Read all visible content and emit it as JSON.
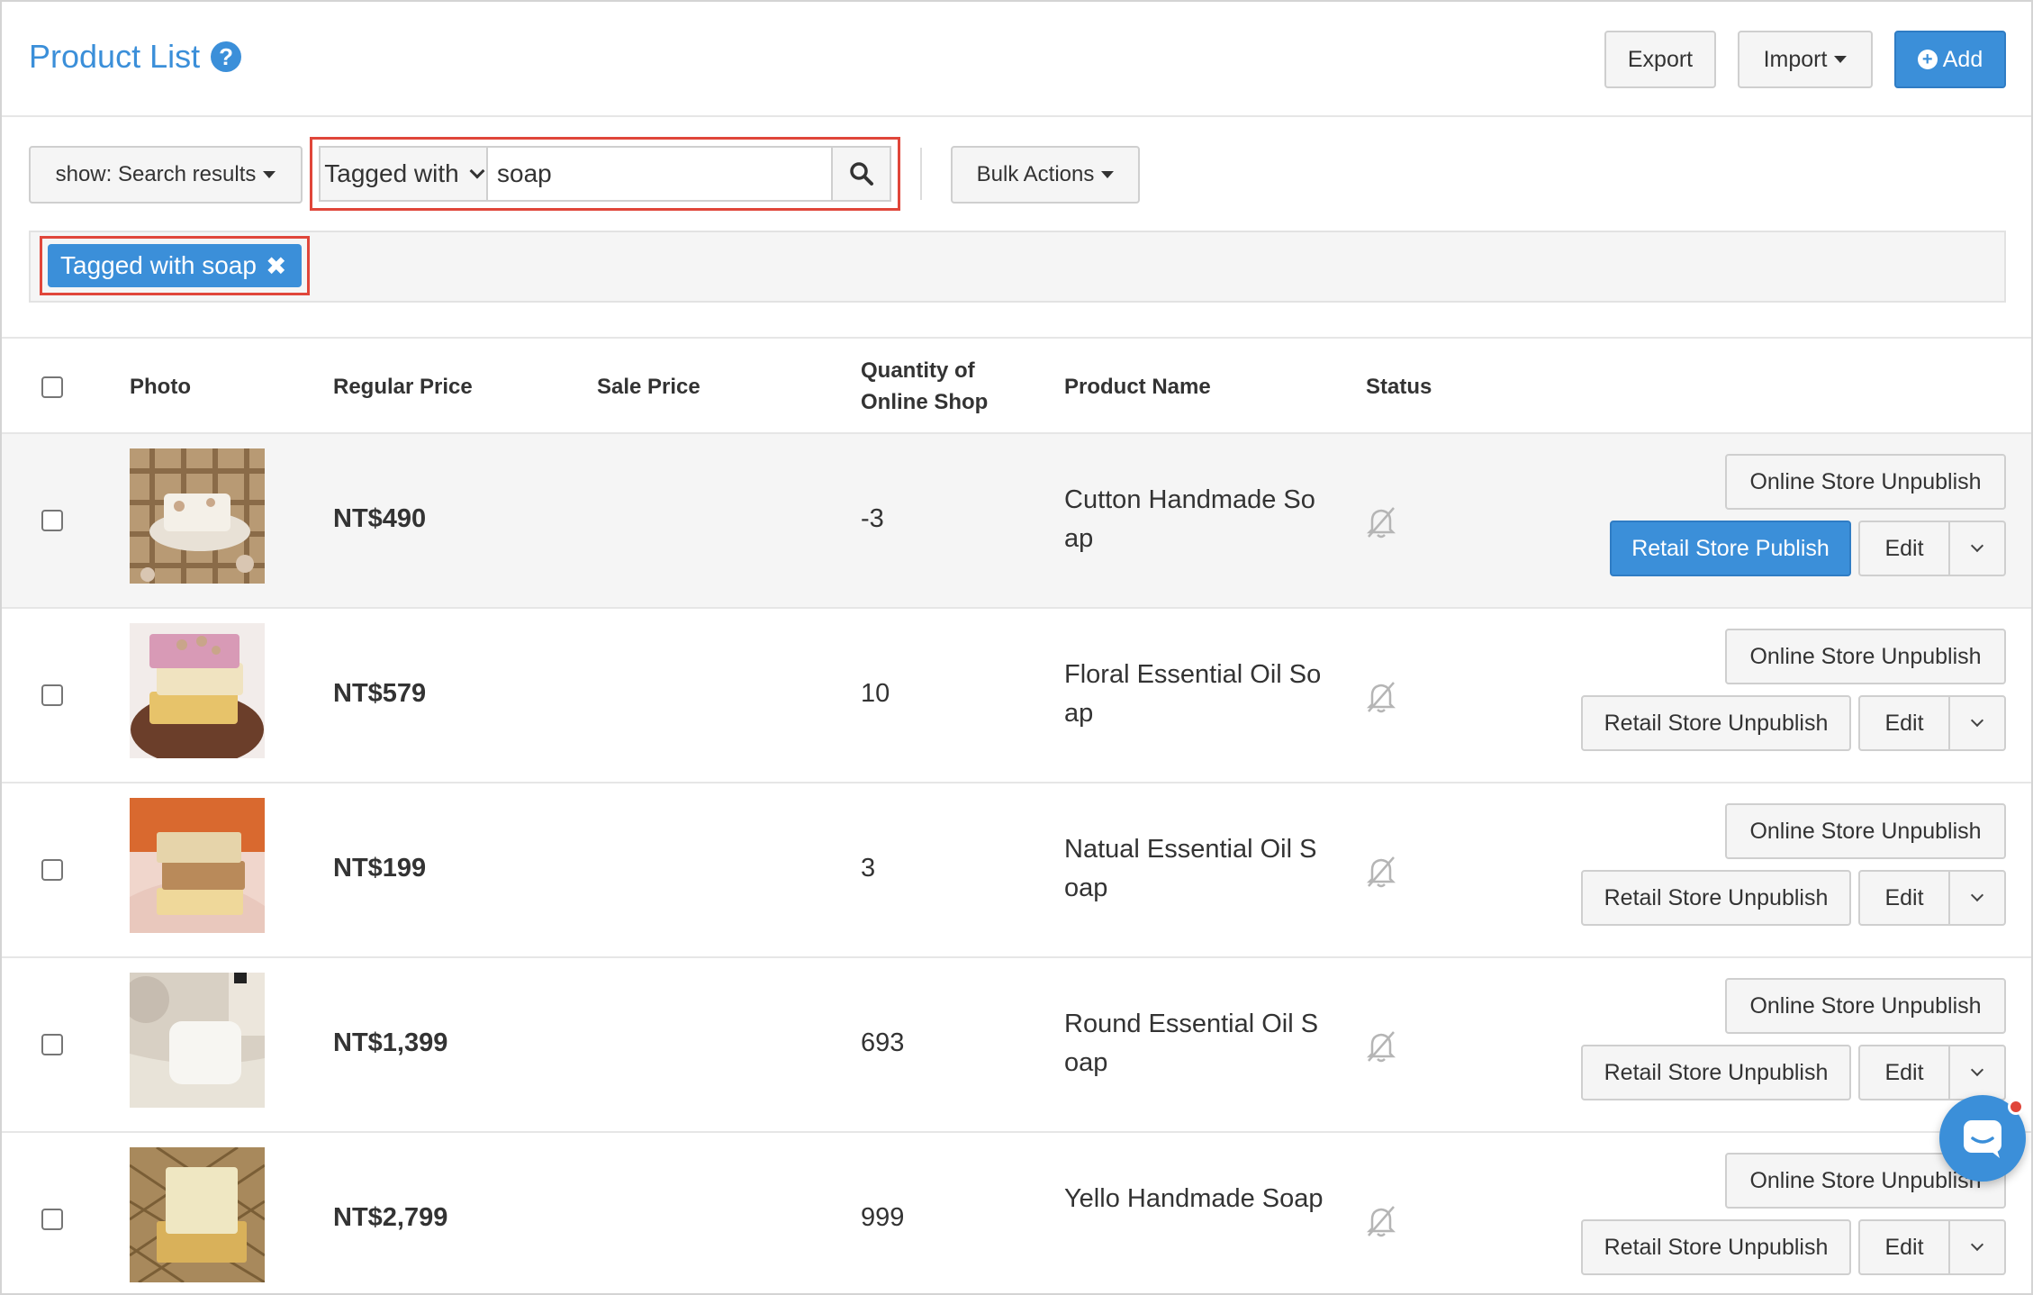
{
  "header": {
    "title": "Product List",
    "export_label": "Export",
    "import_label": "Import",
    "add_label": "Add"
  },
  "filters": {
    "show_label": "show: Search results",
    "search_type": "Tagged with",
    "search_value": "soap",
    "bulk_label": "Bulk Actions",
    "active_chip": "Tagged with soap"
  },
  "table": {
    "headers": {
      "photo": "Photo",
      "regular_price": "Regular Price",
      "sale_price": "Sale Price",
      "qty_line1": "Quantity of",
      "qty_line2": "Online Shop",
      "product_name": "Product Name",
      "status": "Status"
    },
    "rows": [
      {
        "regular_price": "NT$490",
        "sale_price": "",
        "qty": "-3",
        "name": "Cutton Handmade Soap",
        "online_btn": "Online Store Unpublish",
        "retail_btn": "Retail Store Publish",
        "edit": "Edit",
        "status_icon": "bell-off-icon"
      },
      {
        "regular_price": "NT$579",
        "sale_price": "",
        "qty": "10",
        "name": "Floral Essential Oil Soap",
        "online_btn": "Online Store Unpublish",
        "retail_btn": "Retail Store Unpublish",
        "edit": "Edit",
        "status_icon": "bell-off-icon"
      },
      {
        "regular_price": "NT$199",
        "sale_price": "",
        "qty": "3",
        "name": "Natual Essential Oil Soap",
        "online_btn": "Online Store Unpublish",
        "retail_btn": "Retail Store Unpublish",
        "edit": "Edit",
        "status_icon": "bell-off-icon"
      },
      {
        "regular_price": "NT$1,399",
        "sale_price": "",
        "qty": "693",
        "name": "Round Essential Oil Soap",
        "online_btn": "Online Store Unpublish",
        "retail_btn": "Retail Store Unpublish",
        "edit": "Edit",
        "status_icon": "bell-off-icon"
      },
      {
        "regular_price": "NT$2,799",
        "sale_price": "",
        "qty": "999",
        "name": "Yello Handmade Soap",
        "online_btn": "Online Store Unpublish",
        "retail_btn": "Retail Store Unpublish",
        "edit": "Edit",
        "status_icon": "bell-off-icon"
      }
    ]
  },
  "colors": {
    "accent": "#3b8fd9",
    "highlight": "#e0463a"
  }
}
